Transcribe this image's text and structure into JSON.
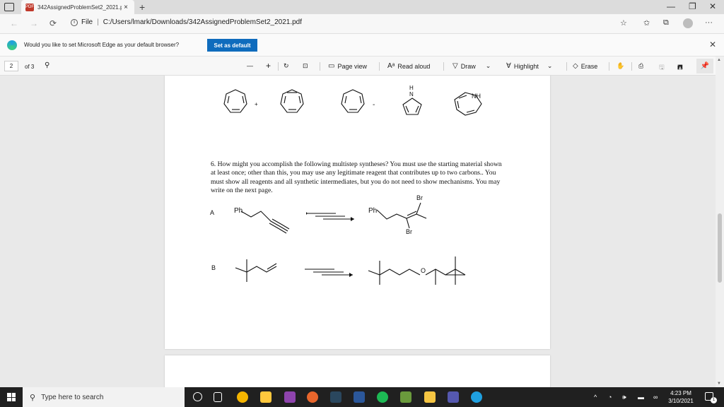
{
  "tab": {
    "title": "342AssignedProblemSet2_2021.p",
    "close": "×",
    "new_tab": "+",
    "badge": "PDF"
  },
  "window_controls": {
    "minimize": "—",
    "restore": "❐",
    "close": "✕"
  },
  "nav": {
    "back": "←",
    "forward": "→",
    "refresh": "⟳"
  },
  "address": {
    "info_icon": "i",
    "scheme": "File",
    "separator": "|",
    "url": "C:/Users/lmark/Downloads/342AssignedProblemSet2_2021.pdf"
  },
  "browser_tools": {
    "favorite": "☆",
    "favorites": "✩",
    "collections": "⧉",
    "more": "···"
  },
  "infobar": {
    "message": "Would you like to set Microsoft Edge as your default browser?",
    "button": "Set as default",
    "close": "✕"
  },
  "pdf_toolbar": {
    "page_number": "2",
    "page_total": "of 3",
    "search_icon": "⚲",
    "zoom_out": "—",
    "zoom_in": "+",
    "rotate": "↻",
    "fit": "⊡",
    "page_view": "Page view",
    "read_aloud": "Read aloud",
    "draw": "Draw",
    "highlight": "Highlight",
    "erase": "Erase",
    "dropdown": "⌄",
    "touch": "✋",
    "print": "⎙",
    "save": "🖫",
    "save_as": "🖪",
    "pin": "📌"
  },
  "document": {
    "question": "6. How might you accomplish the following multistep syntheses? You must use the starting material shown at least once; other than this, you may use any legitimate reagent that contributes up to two carbons.. You must show all reagents and all synthetic intermediates, but you do not need to show mechanisms. You may write on the next page.",
    "label_a": "A",
    "label_b": "B",
    "ph": "Ph",
    "br": "Br",
    "nh": "NH",
    "n": "N",
    "h": "H",
    "o": "O",
    "plus": "+",
    "minus": "-",
    "colors": {
      "ink": "#111111",
      "page": "#ffffff"
    }
  },
  "taskbar": {
    "search_placeholder": "Type here to search",
    "tray_up": "^",
    "volume": "🕪",
    "time": "4:23 PM",
    "date": "3/10/2021",
    "notification_count": "1"
  },
  "colors": {
    "accent": "#0f6cbd",
    "taskbar": "#202020",
    "viewer_bg": "#e9e9e9"
  }
}
